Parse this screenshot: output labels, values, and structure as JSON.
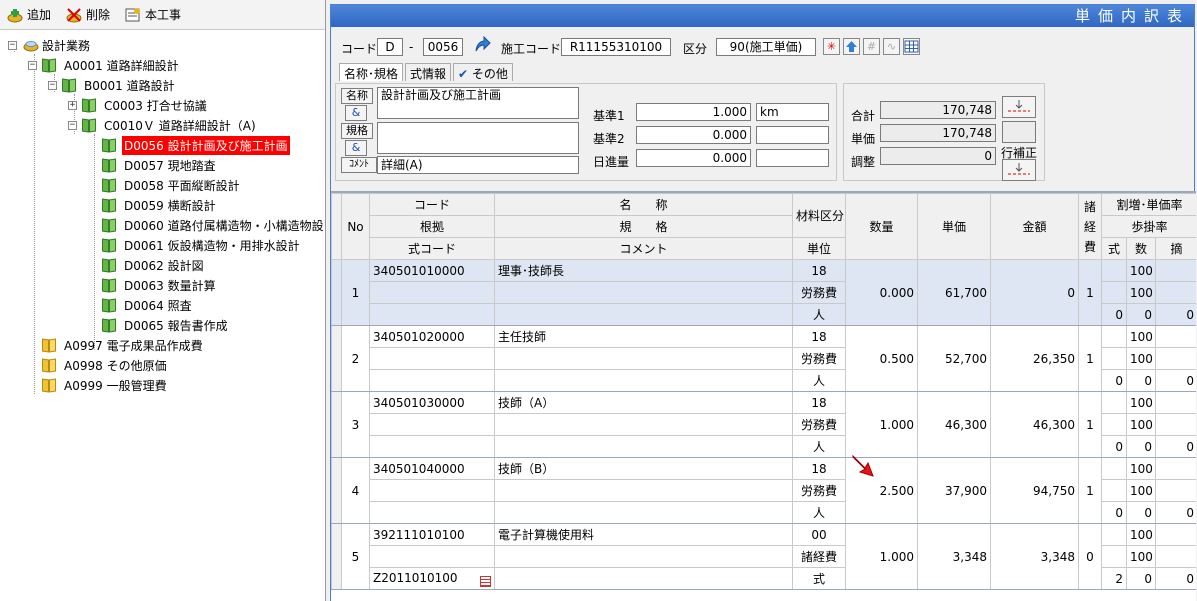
{
  "toolbar": {
    "add": "追加",
    "delete": "削除",
    "main_work": "本工事"
  },
  "tree": {
    "root": "設計業務",
    "a0001": "A0001 道路詳細設計",
    "b0001": "B0001 道路設計",
    "c0003": "C0003 打合せ協議",
    "c0010": "C0010Ｖ 道路詳細設計（A)",
    "d0056": "D0056 設計計画及び施工計画",
    "d0057": "D0057 現地踏査",
    "d0058": "D0058 平面縦断設計",
    "d0059": "D0059 横断設計",
    "d0060": "D0060 道路付属構造物・小構造物設",
    "d0061": "D0061 仮設構造物・用排水設計",
    "d0062": "D0062 設計図",
    "d0063": "D0063 数量計算",
    "d0064": "D0064 照査",
    "d0065": "D0065 報告書作成",
    "a0997": "A0997 電子成果品作成費",
    "a0998": "A0998 その他原価",
    "a0999": "A0999 一般管理費"
  },
  "header": {
    "title": "単価内訳表",
    "code_label": "コード",
    "code_prefix": "D",
    "code_dash": "-",
    "code_num": "0056",
    "sekou_label": "施工コード",
    "sekou_code": "R11155310100",
    "kubun_label": "区分",
    "kubun_value": "90(施工単価)"
  },
  "tabs": [
    "名称･規格",
    "式情報",
    "その他"
  ],
  "form": {
    "name_label": "名称",
    "name_value": "設計計画及び施工計画",
    "amp": "&",
    "spec_label": "規格",
    "spec_value": "",
    "comment_label": "ｺﾒﾝﾄ",
    "comment_value": "詳細(A)",
    "kijun1_label": "基準1",
    "kijun1_value": "1.000",
    "kijun1_unit": "km",
    "kijun2_label": "基準2",
    "kijun2_value": "0.000",
    "kijun2_unit": "",
    "nisshin_label": "日進量",
    "nisshin_value": "0.000",
    "nisshin_unit": ""
  },
  "totals": {
    "total_label": "合計",
    "total_value": "170,748",
    "unit_label": "単価",
    "unit_value": "170,748",
    "adjust_label": "調整",
    "adjust_value": "0",
    "row_correct_label": "行補正"
  },
  "grid_headers": {
    "no": "No",
    "code": "コード",
    "basis": "根拠",
    "formula_code": "式コード",
    "name": "名　　称",
    "spec": "規　　格",
    "comment": "コメント",
    "material": "材料区分",
    "unit": "単位",
    "qty": "数量",
    "price": "単価",
    "amount": "金額",
    "misc": "諸経費",
    "rate": "割増･単価率",
    "step_rate": "歩掛率",
    "shiki": "式",
    "kazu": "数",
    "teki": "摘"
  },
  "rows": [
    {
      "no": "1",
      "code": "340501010000",
      "name": "理事･技師長",
      "mat": "18",
      "mat2": "労務費",
      "unit": "人",
      "basis": "",
      "formula": "",
      "comment": "",
      "qty": "0.000",
      "price": "61,700",
      "amount": "0",
      "misc": "1",
      "r1": "100",
      "r2": "100",
      "s": "0",
      "k": "0",
      "t": "0"
    },
    {
      "no": "2",
      "code": "340501020000",
      "name": "主任技師",
      "mat": "18",
      "mat2": "労務費",
      "unit": "人",
      "basis": "",
      "formula": "",
      "comment": "",
      "qty": "0.500",
      "price": "52,700",
      "amount": "26,350",
      "misc": "1",
      "r1": "100",
      "r2": "100",
      "s": "0",
      "k": "0",
      "t": "0"
    },
    {
      "no": "3",
      "code": "340501030000",
      "name": "技師（A）",
      "mat": "18",
      "mat2": "労務費",
      "unit": "人",
      "basis": "",
      "formula": "",
      "comment": "",
      "qty": "1.000",
      "price": "46,300",
      "amount": "46,300",
      "misc": "1",
      "r1": "100",
      "r2": "100",
      "s": "0",
      "k": "0",
      "t": "0"
    },
    {
      "no": "4",
      "code": "340501040000",
      "name": "技師（B）",
      "mat": "18",
      "mat2": "労務費",
      "unit": "人",
      "basis": "",
      "formula": "",
      "comment": "",
      "qty": "2.500",
      "price": "37,900",
      "amount": "94,750",
      "misc": "1",
      "r1": "100",
      "r2": "100",
      "s": "0",
      "k": "0",
      "t": "0"
    },
    {
      "no": "5",
      "code": "392111010100",
      "name": "電子計算機使用料",
      "mat": "00",
      "mat2": "諸経費",
      "unit": "式",
      "basis": "",
      "formula": "Z2011010100",
      "comment": "",
      "qty": "1.000",
      "price": "3,348",
      "amount": "3,348",
      "misc": "0",
      "r1": "100",
      "r2": "100",
      "s": "2",
      "k": "0",
      "t": "0"
    }
  ]
}
